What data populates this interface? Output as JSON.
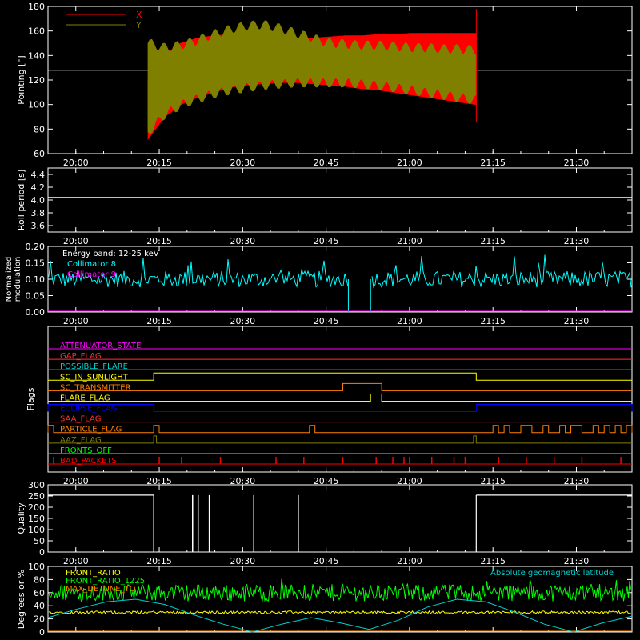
{
  "figure": {
    "background": "#000000",
    "foreground": "#ffffff",
    "time_ticks": [
      "20:00",
      "20:15",
      "20:30",
      "20:45",
      "21:00",
      "21:15",
      "21:30"
    ]
  },
  "chart_data": [
    {
      "id": "pointing",
      "type": "line",
      "ylabel": "Pointing [\"]",
      "ylim": [
        60,
        180
      ],
      "yticks": [
        60,
        80,
        100,
        120,
        140,
        160,
        180
      ],
      "reference_line": 128,
      "data_span": [
        "20:13",
        "21:12"
      ],
      "series": [
        {
          "name": "X",
          "color": "#ff0000",
          "envelope_low": [
            72,
            90,
            100,
            106,
            110,
            114,
            116,
            117,
            118,
            118,
            117,
            116,
            115,
            113,
            112,
            110,
            108,
            106,
            104,
            102,
            100
          ],
          "envelope_high": [
            120,
            140,
            150,
            154,
            156,
            157,
            157,
            156,
            155,
            154,
            154,
            155,
            156,
            156,
            157,
            157,
            158,
            158,
            158,
            158,
            158
          ]
        },
        {
          "name": "Y",
          "color": "#808000",
          "envelope_low": [
            78,
            92,
            100,
            105,
            109,
            112,
            114,
            116,
            117,
            118,
            118,
            118,
            118,
            117,
            116,
            114,
            112,
            110,
            108,
            106,
            104
          ],
          "envelope_high": [
            150,
            146,
            148,
            152,
            157,
            161,
            164,
            165,
            162,
            158,
            154,
            150,
            149,
            148,
            148,
            147,
            146,
            146,
            145,
            145,
            144
          ]
        }
      ]
    },
    {
      "id": "roll",
      "type": "line",
      "ylabel": "Roll period [s]",
      "ylim": [
        3.5,
        4.5
      ],
      "yticks": [
        3.6,
        3.8,
        4.0,
        4.2,
        4.4
      ],
      "ytick_labels": [
        "3.6",
        "3.8",
        "4.0",
        "4.2",
        "4.4"
      ],
      "series": [
        {
          "name": "",
          "color": "#ffffff",
          "values": [
            4.04
          ]
        }
      ]
    },
    {
      "id": "modulation",
      "type": "line",
      "ylabel": "Normalized modulation",
      "ylabel_lines": [
        "Normalized",
        "modulation"
      ],
      "ylim": [
        0,
        0.2
      ],
      "yticks": [
        0,
        0.05,
        0.1,
        0.15,
        0.2
      ],
      "ytick_labels": [
        "0.00",
        "0.05",
        "0.10",
        "0.15",
        "0.20"
      ],
      "annotations": [
        "Energy band: 12-25 keV"
      ],
      "series": [
        {
          "name": "Collimator 8",
          "color": "#00ffff",
          "mean": 0.1,
          "gaps": [
            [
              "20:49",
              "20:53"
            ]
          ]
        },
        {
          "name": "Collimator 9",
          "color": "#ff00ff",
          "values": [
            0.0
          ]
        }
      ]
    },
    {
      "id": "flags",
      "type": "line",
      "ylabel": "Flags",
      "series": [
        {
          "name": "ATTENUATOR_STATE",
          "color": "#ff00ff",
          "level_changes": []
        },
        {
          "name": "GAP_FLAG",
          "color": "#ff3030",
          "level_changes": []
        },
        {
          "name": "POSSIBLE_FLARE",
          "color": "#00d0d0",
          "level_changes": []
        },
        {
          "name": "SC_IN_SUNLIGHT",
          "color": "#ffff00",
          "level_changes": [
            [
              "20:14",
              "21:12"
            ]
          ]
        },
        {
          "name": "SC_TRANSMITTER",
          "color": "#ff8000",
          "level_changes": [
            [
              "20:48",
              "20:55"
            ]
          ]
        },
        {
          "name": "FLARE_FLAG",
          "color": "#ffff00",
          "level_changes": [
            [
              "20:53",
              "20:55"
            ]
          ]
        },
        {
          "name": "ECLIPSE_FLAG",
          "color": "#0000ff",
          "level_changes": [
            [
              "19:55",
              "20:14"
            ],
            [
              "21:12",
              "21:40"
            ]
          ]
        },
        {
          "name": "SAA_FLAG",
          "color": "#ff3030",
          "level_changes": []
        },
        {
          "name": "PARTICLE_FLAG",
          "color": "#ff8000",
          "level_changes": [
            [
              "19:55",
              "19:56"
            ],
            [
              "20:14",
              "20:15"
            ],
            [
              "20:42",
              "20:43"
            ],
            [
              "21:15",
              "21:16"
            ],
            [
              "21:17",
              "21:18"
            ],
            [
              "21:20",
              "21:22"
            ],
            [
              "21:24",
              "21:25"
            ],
            [
              "21:27",
              "21:28"
            ],
            [
              "21:29",
              "21:31"
            ],
            [
              "21:33",
              "21:34"
            ],
            [
              "21:35",
              "21:36"
            ],
            [
              "21:37",
              "21:38"
            ],
            [
              "21:39",
              "21:40"
            ]
          ]
        },
        {
          "name": "AAZ_FLAG",
          "color": "#808000",
          "level_changes": [
            [
              "20:14",
              "20:14.5"
            ],
            [
              "21:11.5",
              "21:12"
            ]
          ]
        },
        {
          "name": "FRONTS_OFF",
          "color": "#00ff00",
          "level_changes": []
        },
        {
          "name": "BAD_PACKETS",
          "color": "#ff0000",
          "spikes": [
            "19:56",
            "20:15",
            "20:19",
            "20:26",
            "20:36",
            "20:41",
            "20:48",
            "20:54",
            "20:57",
            "20:59",
            "21:00",
            "21:04",
            "21:08",
            "21:10",
            "21:16",
            "21:21",
            "21:26",
            "21:31",
            "21:38"
          ]
        }
      ]
    },
    {
      "id": "quality",
      "type": "line",
      "ylabel": "Quality",
      "ylim": [
        0,
        300
      ],
      "yticks": [
        0,
        50,
        100,
        150,
        200,
        250,
        300
      ],
      "series": [
        {
          "name": "",
          "color": "#ffffff",
          "high_value": 254,
          "high_spans": [
            [
              "19:55",
              "20:14"
            ],
            [
              "21:12",
              "21:40"
            ]
          ],
          "spikes": [
            "20:21",
            "20:22",
            "20:24",
            "20:32",
            "20:40"
          ]
        }
      ]
    },
    {
      "id": "ratios",
      "type": "line",
      "ylabel": "Degrees or %",
      "ylim": [
        0,
        100
      ],
      "yticks": [
        0,
        20,
        40,
        60,
        80,
        100
      ],
      "series": [
        {
          "name": "FRONT_RATIO",
          "color": "#ffff00",
          "mean": 30
        },
        {
          "name": "FRONT_RATIO_1225",
          "color": "#00ff00",
          "mean": 60
        },
        {
          "name": "MAX_DETUNE_TOT",
          "color": "#ff8000",
          "mean": 0
        },
        {
          "name": "Absolute geomagnetic latitude",
          "color": "#00d0d0",
          "values": [
            22,
            35,
            46,
            50,
            42,
            26,
            12,
            0,
            12,
            22,
            14,
            4,
            18,
            38,
            50,
            46,
            30,
            12,
            0,
            14,
            24
          ]
        }
      ]
    }
  ]
}
